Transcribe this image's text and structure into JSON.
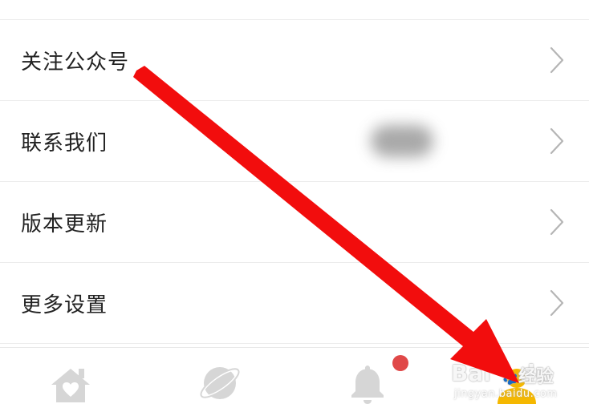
{
  "menu": {
    "items": [
      {
        "label": "关注公众号"
      },
      {
        "label": "联系我们"
      },
      {
        "label": "版本更新"
      },
      {
        "label": "更多设置"
      }
    ]
  },
  "tabbar": {
    "tabs": [
      {
        "icon": "home-icon"
      },
      {
        "icon": "planet-icon"
      },
      {
        "icon": "bell-icon"
      },
      {
        "icon": "profile-icon"
      }
    ],
    "notification_badge_color": "#e04848"
  },
  "watermark": {
    "brand": "Bai",
    "brand_tail": "du",
    "jingyan": "经验",
    "url": "jingyan.baidu.com"
  },
  "annotation": {
    "arrow_color": "#f20d0d"
  },
  "colors": {
    "text": "#222222",
    "chevron": "#b5b5b5",
    "tab_icon": "#d6d6d6",
    "profile_active": "#f5b800"
  }
}
